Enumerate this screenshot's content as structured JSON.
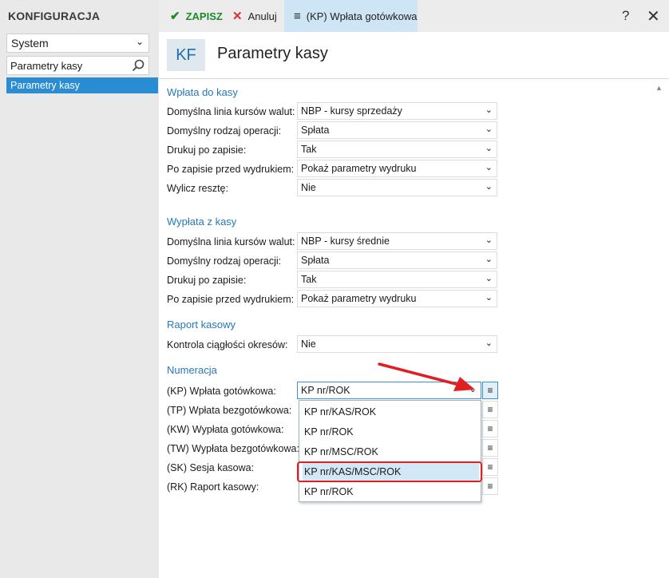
{
  "app": {
    "title": "KONFIGURACJA"
  },
  "sidebar": {
    "module_select": "System",
    "search_value": "Parametry kasy",
    "items": [
      {
        "label": "Parametry kasy"
      }
    ]
  },
  "toolbar": {
    "save_label": "ZAPISZ",
    "cancel_label": "Anuluj",
    "active_tab_label": "(KP) Wpłata gotówkowa",
    "help_label": "?"
  },
  "header": {
    "badge": "KF",
    "title": "Parametry kasy"
  },
  "sections": {
    "wplata": {
      "title": "Wpłata do kasy",
      "rows": [
        {
          "label": "Domyślna linia kursów walut:",
          "value": "NBP - kursy sprzedaży"
        },
        {
          "label": "Domyślny rodzaj operacji:",
          "value": "Spłata"
        },
        {
          "label": "Drukuj po zapisie:",
          "value": "Tak"
        },
        {
          "label": "Po zapisie przed wydrukiem:",
          "value": "Pokaż parametry wydruku"
        },
        {
          "label": "Wylicz resztę:",
          "value": "Nie"
        }
      ]
    },
    "wyplata": {
      "title": "Wypłata z kasy",
      "rows": [
        {
          "label": "Domyślna linia kursów walut:",
          "value": "NBP - kursy średnie"
        },
        {
          "label": "Domyślny rodzaj operacji:",
          "value": "Spłata"
        },
        {
          "label": "Drukuj po zapisie:",
          "value": "Tak"
        },
        {
          "label": "Po zapisie przed wydrukiem:",
          "value": "Pokaż parametry wydruku"
        }
      ]
    },
    "raport": {
      "title": "Raport kasowy",
      "rows": [
        {
          "label": "Kontrola ciągłości okresów:",
          "value": "Nie"
        }
      ]
    },
    "numeracja": {
      "title": "Numeracja",
      "rows": [
        {
          "label": "(KP) Wpłata gotówkowa:",
          "value": "KP nr/ROK"
        },
        {
          "label": "(TP) Wpłata bezgotówkowa:"
        },
        {
          "label": "(KW) Wypłata gotówkowa:"
        },
        {
          "label": "(TW) Wypłata bezgotówkowa:"
        },
        {
          "label": "(SK) Sesja kasowa:"
        },
        {
          "label": "(RK) Raport kasowy:"
        }
      ],
      "dropdown_options": [
        "KP nr/KAS/ROK",
        "KP nr/ROK",
        "KP nr/MSC/ROK",
        "KP nr/KAS/MSC/ROK",
        "KP nr/ROK"
      ],
      "highlighted_option_index": 3
    }
  },
  "colors": {
    "accent": "#2a8dd4",
    "section_title": "#2878b8",
    "save": "#1f8a2a",
    "cancel": "#d93030",
    "annotation": "#e02020"
  }
}
